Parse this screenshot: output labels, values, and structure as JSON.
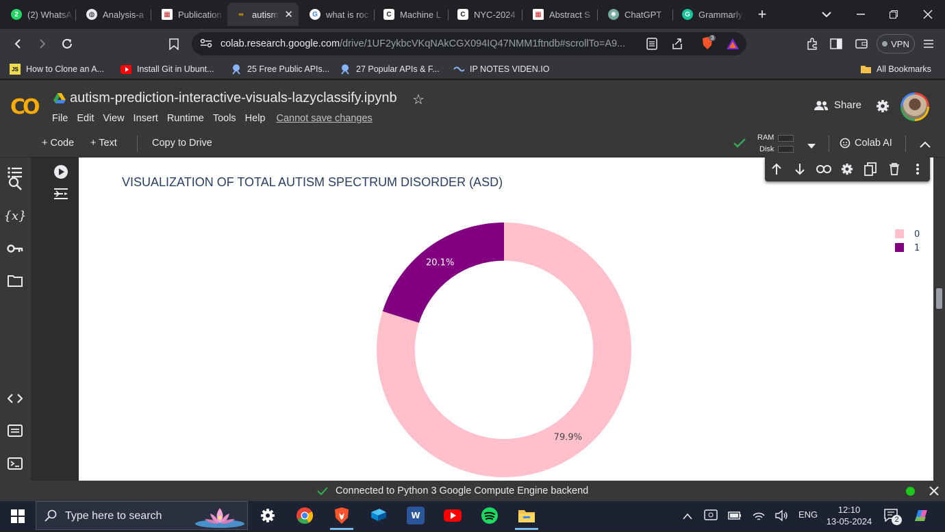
{
  "browser": {
    "tabs": [
      {
        "title": "(2) WhatsA",
        "icon": "whatsapp-icon",
        "badge": "2"
      },
      {
        "title": "Analysis-a",
        "icon": "globe-icon"
      },
      {
        "title": "Publication",
        "icon": "publication-icon"
      },
      {
        "title": "autism",
        "icon": "colab-icon",
        "active": true
      },
      {
        "title": "what is roc",
        "icon": "google-icon"
      },
      {
        "title": "Machine L",
        "icon": "doc-icon"
      },
      {
        "title": "NYC-2024",
        "icon": "doc-icon"
      },
      {
        "title": "Abstract S",
        "icon": "publication-icon"
      },
      {
        "title": "ChatGPT",
        "icon": "chatgpt-icon"
      },
      {
        "title": "Grammarly",
        "icon": "grammarly-icon"
      }
    ],
    "url_domain": "colab.research.google.com",
    "url_path": "/drive/1UF2ykbcVKqNAkCGX094IQ47NMM1ftndb#scrollTo=A9...",
    "vpn_label": "VPN",
    "brave_badge": "3",
    "bookmarks": [
      {
        "label": "How to Clone an A...",
        "icon": "js-icon",
        "icon_text": "JS"
      },
      {
        "label": "Install Git in Ubunt...",
        "icon": "youtube-icon"
      },
      {
        "label": "25 Free Public APIs...",
        "icon": "bookmark-site-icon"
      },
      {
        "label": "27 Popular APIs & F...",
        "icon": "bookmark-site-icon"
      },
      {
        "label": "IP NOTES VIDEN.IO",
        "icon": "viden-icon"
      }
    ],
    "all_bookmarks": "All Bookmarks"
  },
  "colab": {
    "logo": "CO",
    "notebook_title": "autism-prediction-interactive-visuals-lazyclassify.ipynb",
    "menu": [
      "File",
      "Edit",
      "View",
      "Insert",
      "Runtime",
      "Tools",
      "Help"
    ],
    "cannot_save": "Cannot save changes",
    "share": "Share",
    "toolbar": {
      "code": "+ Code",
      "text": "+ Text",
      "copy_to_drive": "Copy to Drive",
      "ram": "RAM",
      "disk": "Disk",
      "colab_ai": "Colab AI"
    },
    "status": "Connected to Python 3 Google Compute Engine backend"
  },
  "chart_data": {
    "type": "pie",
    "title": "VISUALIZATION OF TOTAL AUTISM SPECTRUM DISORDER (ASD)",
    "hole": 0.7,
    "labels": [
      "0",
      "1"
    ],
    "values": [
      79.9,
      20.1
    ],
    "value_labels": [
      "79.9%",
      "20.1%"
    ],
    "colors": [
      "#ffc0cb",
      "#800080"
    ],
    "legend": "top-right"
  },
  "taskbar": {
    "search_placeholder": "Type here to search",
    "language": "ENG",
    "time": "12:10",
    "date": "13-05-2024",
    "notifications": "2"
  }
}
